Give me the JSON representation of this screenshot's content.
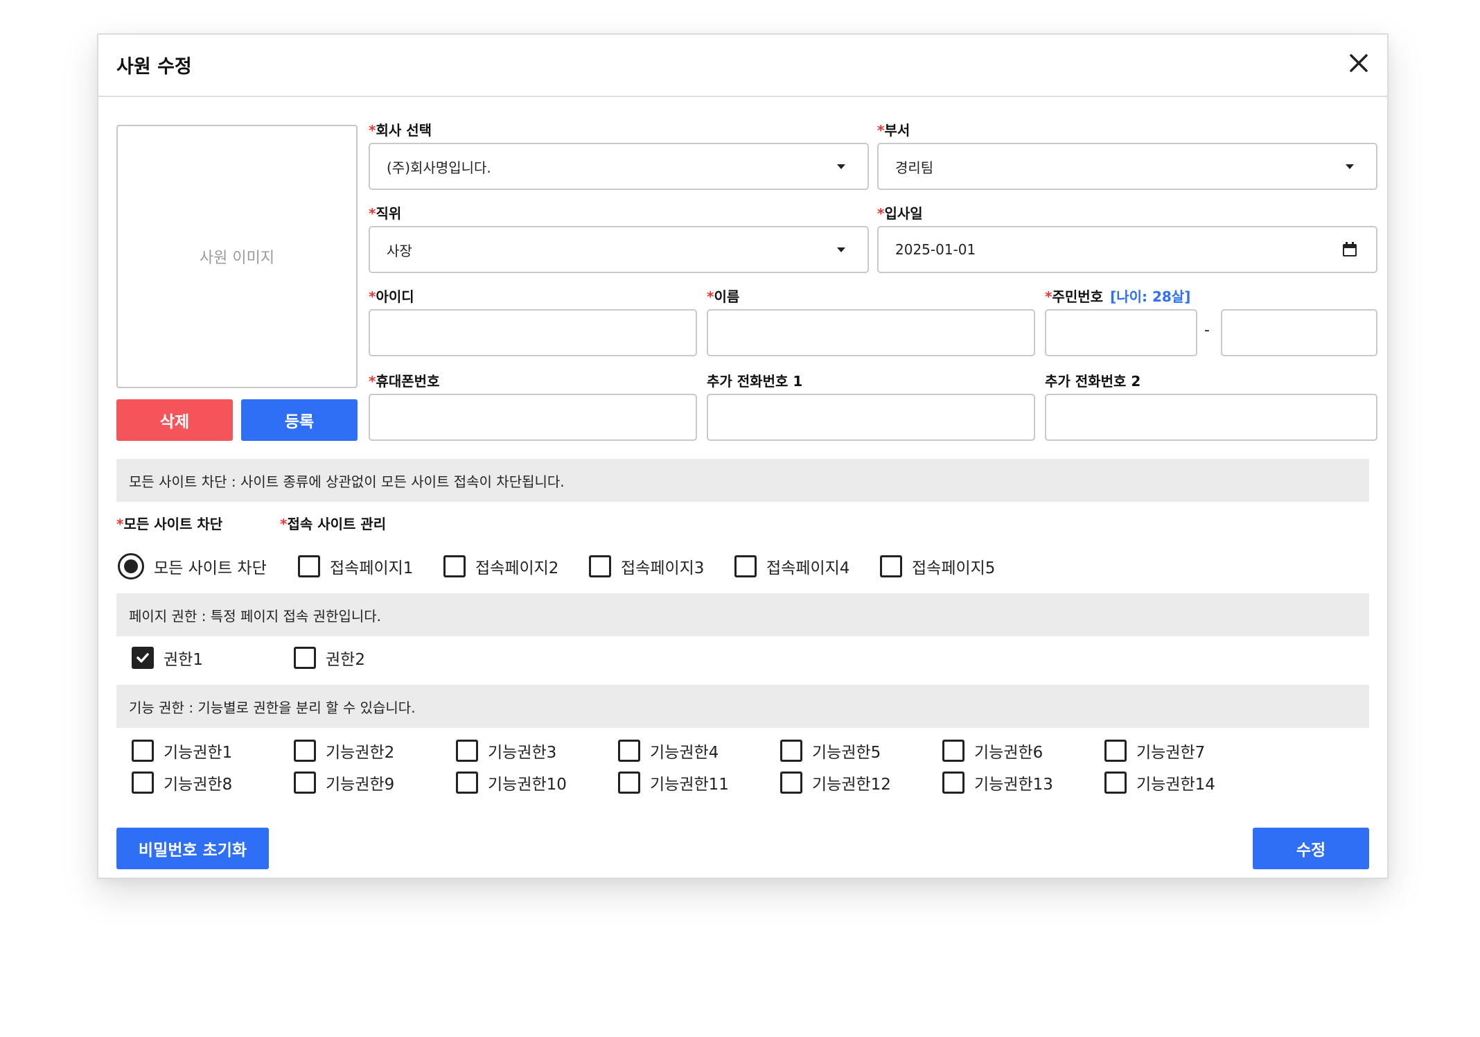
{
  "modal": {
    "title": "사원 수정",
    "photo_placeholder": "사원 이미지",
    "delete_label": "삭제",
    "register_label": "등록"
  },
  "fields": {
    "company": {
      "label": "회사 선택",
      "value": "(주)회사명입니다."
    },
    "department": {
      "label": "부서",
      "value": "경리팀"
    },
    "position": {
      "label": "직위",
      "value": "사장"
    },
    "join_date": {
      "label": "입사일",
      "value": "2025-01-01"
    },
    "user_id": {
      "label": "아이디",
      "value": ""
    },
    "name": {
      "label": "이름",
      "value": ""
    },
    "resident_number": {
      "label": "주민번호",
      "age_note": "[나이: 28살]",
      "front": "",
      "back": "",
      "separator": "-"
    },
    "mobile": {
      "label": "휴대폰번호",
      "value": ""
    },
    "extra_phone_1": {
      "label": "추가 전화번호 1",
      "value": ""
    },
    "extra_phone_2": {
      "label": "추가 전화번호 2",
      "value": ""
    }
  },
  "site_block": {
    "info": "모든 사이트 차단 :  사이트 종류에 상관없이 모든 사이트 접속이 차단됩니다.",
    "block_all_label": "모든 사이트 차단",
    "manage_label": "접속 사이트 관리",
    "radio_label": "모든 사이트 차단",
    "radio_selected": true,
    "pages": [
      {
        "label": "접속페이지1",
        "checked": false
      },
      {
        "label": "접속페이지2",
        "checked": false
      },
      {
        "label": "접속페이지3",
        "checked": false
      },
      {
        "label": "접속페이지4",
        "checked": false
      },
      {
        "label": "접속페이지5",
        "checked": false
      }
    ]
  },
  "page_permission": {
    "info": "페이지 권한 :  특정 페이지 접속 권한입니다.",
    "items": [
      {
        "label": "권한1",
        "checked": true
      },
      {
        "label": "권한2",
        "checked": false
      }
    ]
  },
  "feature_permission": {
    "info": "기능 권한 :  기능별로 권한을 분리 할 수 있습니다.",
    "items": [
      {
        "label": "기능권한1",
        "checked": false
      },
      {
        "label": "기능권한2",
        "checked": false
      },
      {
        "label": "기능권한3",
        "checked": false
      },
      {
        "label": "기능권한4",
        "checked": false
      },
      {
        "label": "기능권한5",
        "checked": false
      },
      {
        "label": "기능권한6",
        "checked": false
      },
      {
        "label": "기능권한7",
        "checked": false
      },
      {
        "label": "기능권한8",
        "checked": false
      },
      {
        "label": "기능권한9",
        "checked": false
      },
      {
        "label": "기능권한10",
        "checked": false
      },
      {
        "label": "기능권한11",
        "checked": false
      },
      {
        "label": "기능권한12",
        "checked": false
      },
      {
        "label": "기능권한13",
        "checked": false
      },
      {
        "label": "기능권한14",
        "checked": false
      }
    ]
  },
  "footer": {
    "reset_password_label": "비밀번호 초기화",
    "submit_label": "수정"
  },
  "required_mark": "*",
  "colors": {
    "primary": "#2f6ff5",
    "danger": "#f4545a",
    "required": "#e53935",
    "info_bar": "#ebebeb"
  }
}
